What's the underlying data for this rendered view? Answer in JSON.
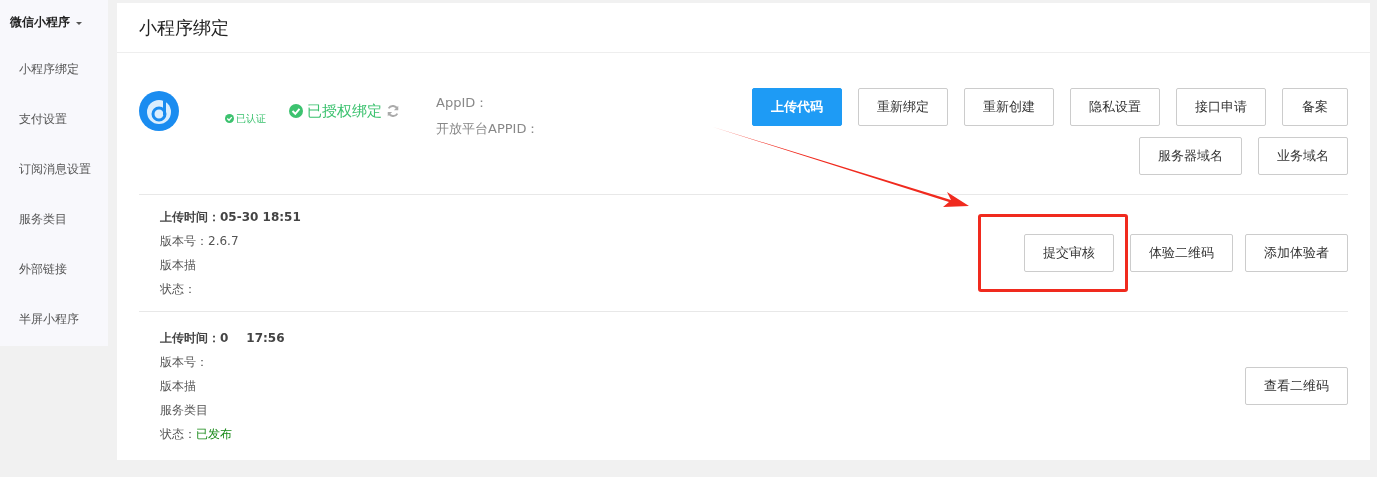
{
  "sidebar": {
    "title": "微信小程序",
    "expanded": true,
    "items": [
      {
        "label": "小程序绑定",
        "selected": false
      },
      {
        "label": "支付设置",
        "selected": false
      },
      {
        "label": "订阅消息设置",
        "selected": false
      },
      {
        "label": "服务类目",
        "selected": false
      },
      {
        "label": "外部链接",
        "selected": false
      },
      {
        "label": "半屏小程序",
        "selected": false
      }
    ]
  },
  "page_title": "小程序绑定",
  "app": {
    "verified_label": "已认证",
    "auth_status": "已授权绑定",
    "appid_label": "AppID：",
    "open_appid_label": "开放平台APPID："
  },
  "actions": [
    {
      "label": "上传代码",
      "kind": "primary"
    },
    {
      "label": "重新绑定",
      "kind": "default"
    },
    {
      "label": "重新创建",
      "kind": "default"
    },
    {
      "label": "隐私设置",
      "kind": "default"
    },
    {
      "label": "接口申请",
      "kind": "default"
    },
    {
      "label": "备案",
      "kind": "default"
    },
    {
      "label": "服务器域名",
      "kind": "default"
    },
    {
      "label": "业务域名",
      "kind": "default"
    }
  ],
  "versions": [
    {
      "lines": [
        {
          "text": "上传时间：05-30 18:51",
          "kind": "bold"
        },
        {
          "text": "版本号：2.6.7",
          "kind": "plain"
        },
        {
          "text": "版本描",
          "kind": "plain"
        },
        {
          "text": "状态：",
          "kind": "plain"
        }
      ],
      "buttons": [
        {
          "label": "提交审核",
          "highlighted": true
        },
        {
          "label": "体验二维码",
          "highlighted": false
        },
        {
          "label": "添加体验者",
          "highlighted": false
        }
      ]
    },
    {
      "lines": [
        {
          "text": "上传时间：0",
          "tail": "17:56",
          "kind": "bold"
        },
        {
          "text": "版本号：",
          "kind": "plain"
        },
        {
          "text": "版本描",
          "kind": "plain"
        },
        {
          "text": "服务类目",
          "kind": "plain"
        },
        {
          "text": "状态：",
          "value": "已发布",
          "kind": "status"
        }
      ],
      "buttons": [
        {
          "label": "查看二维码",
          "highlighted": false
        }
      ]
    }
  ]
}
